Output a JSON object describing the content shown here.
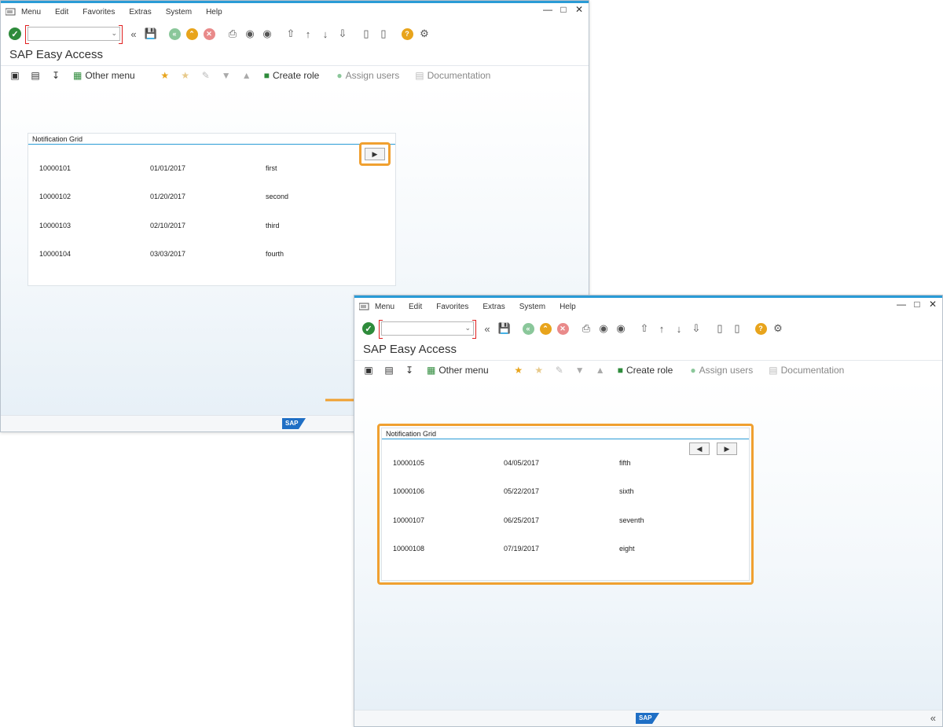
{
  "menu": [
    "Menu",
    "Edit",
    "Favorites",
    "Extras",
    "System",
    "Help"
  ],
  "title": "SAP Easy Access",
  "apptoolbar": {
    "other_menu": "Other menu",
    "create_role": "Create role",
    "assign_users": "Assign users",
    "documentation": "Documentation"
  },
  "grid_title": "Notification Grid",
  "grid1": [
    {
      "id": "10000101",
      "date": "01/01/2017",
      "label": "first"
    },
    {
      "id": "10000102",
      "date": "01/20/2017",
      "label": "second"
    },
    {
      "id": "10000103",
      "date": "02/10/2017",
      "label": "third"
    },
    {
      "id": "10000104",
      "date": "03/03/2017",
      "label": "fourth"
    }
  ],
  "grid2": [
    {
      "id": "10000105",
      "date": "04/05/2017",
      "label": "fifth"
    },
    {
      "id": "10000106",
      "date": "05/22/2017",
      "label": "sixth"
    },
    {
      "id": "10000107",
      "date": "06/25/2017",
      "label": "seventh"
    },
    {
      "id": "10000108",
      "date": "07/19/2017",
      "label": "eight"
    }
  ],
  "sap_logo": "SAP",
  "colors": {
    "accent": "#2a9bd6",
    "highlight": "#f0a030",
    "ok": "#2e8b3b"
  }
}
